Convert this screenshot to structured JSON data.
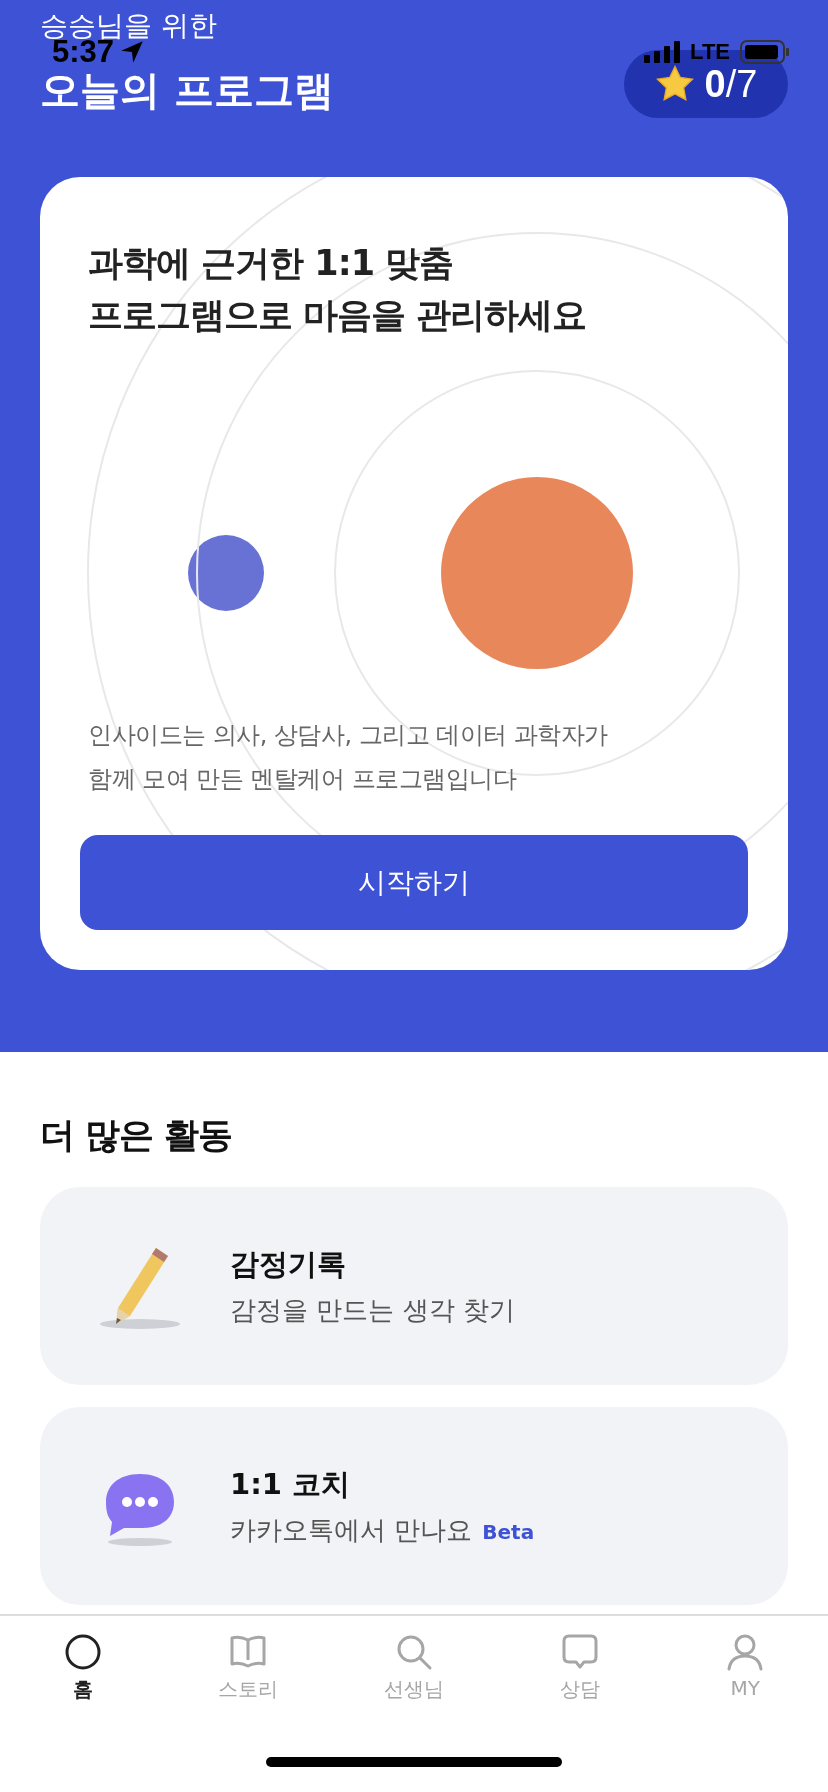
{
  "status_bar": {
    "time": "5:37",
    "network": "LTE"
  },
  "header": {
    "subtitle": "승승님을 위한",
    "title": "오늘의 프로그램",
    "stars_badge": "**0**/7"
  },
  "hero_card": {
    "heading": "과학에 근거한 1:1 맞춤\n프로그램으로 마음을 관리하세요",
    "description": "인사이드는 의사, 상담사, 그리고 데이터 과학자가\n함께 모여 만든 멘탈케어 프로그램입니다",
    "button": "시작하기"
  },
  "more_activities": {
    "title": "더 많은 활동",
    "items": [
      {
        "kind": "pencil",
        "title": "감정기록",
        "subtitle": "감정을 만드는 생각 찾기"
      },
      {
        "kind": "chat",
        "title": "1:1 코치",
        "subtitle": "카카오톡에서 만나요",
        "badge": "Beta"
      }
    ]
  },
  "tab_bar": [
    {
      "kind": "home",
      "label": "홈",
      "selected": true
    },
    {
      "kind": "story",
      "label": "스토리",
      "selected": false
    },
    {
      "kind": "search",
      "label": "선생님",
      "selected": false
    },
    {
      "kind": "chat",
      "label": "상담",
      "selected": false
    },
    {
      "kind": "profile",
      "label": "MY",
      "selected": false
    }
  ]
}
